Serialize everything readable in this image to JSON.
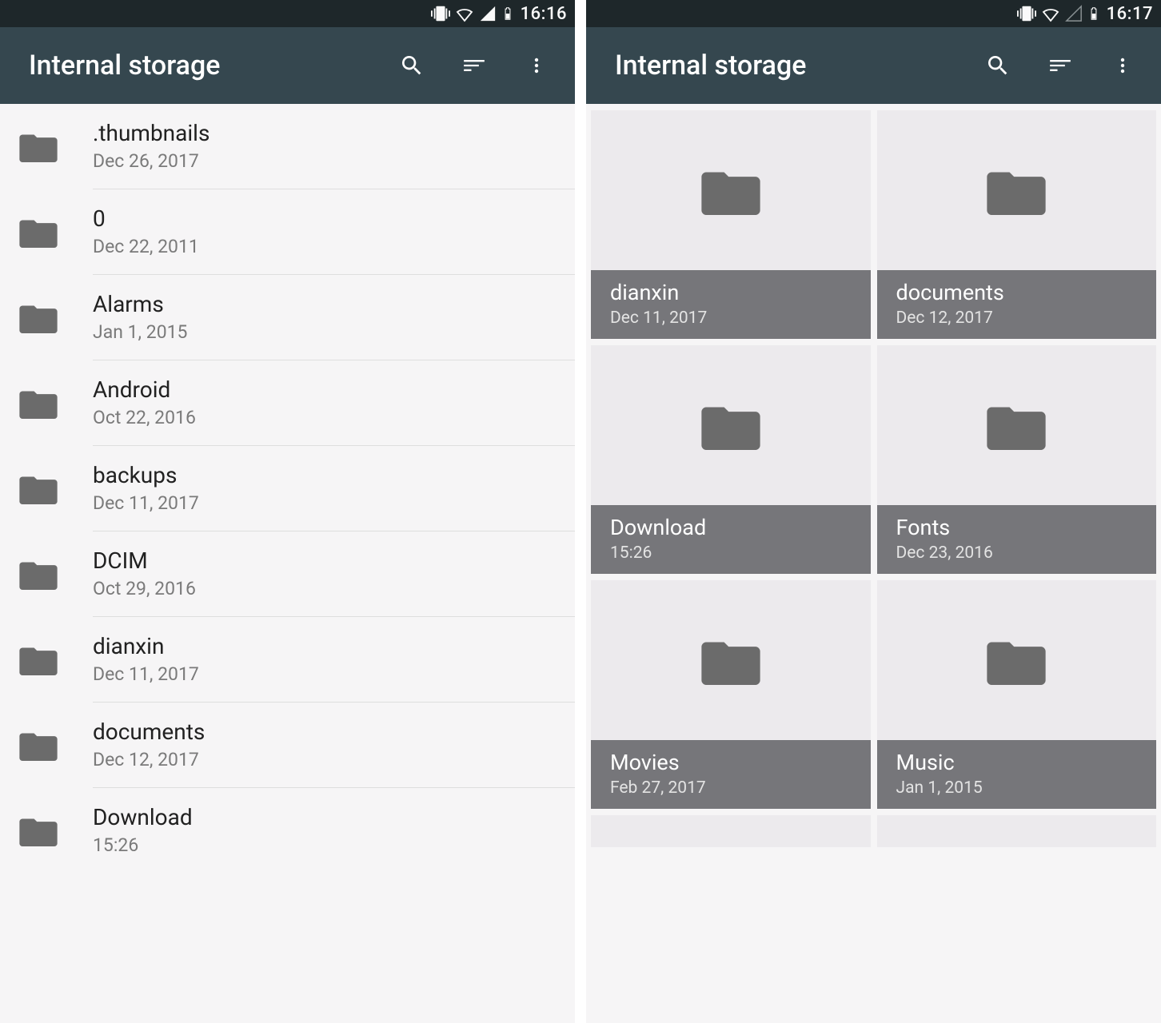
{
  "left": {
    "status": {
      "time": "16:16"
    },
    "header": {
      "title": "Internal storage"
    },
    "items": [
      {
        "name": ".thumbnails",
        "date": "Dec 26, 2017"
      },
      {
        "name": "0",
        "date": "Dec 22, 2011"
      },
      {
        "name": "Alarms",
        "date": "Jan 1, 2015"
      },
      {
        "name": "Android",
        "date": "Oct 22, 2016"
      },
      {
        "name": "backups",
        "date": "Dec 11, 2017"
      },
      {
        "name": "DCIM",
        "date": "Oct 29, 2016"
      },
      {
        "name": "dianxin",
        "date": "Dec 11, 2017"
      },
      {
        "name": "documents",
        "date": "Dec 12, 2017"
      },
      {
        "name": "Download",
        "date": "15:26"
      }
    ]
  },
  "right": {
    "status": {
      "time": "16:17"
    },
    "header": {
      "title": "Internal storage"
    },
    "items": [
      {
        "name": "dianxin",
        "date": "Dec 11, 2017"
      },
      {
        "name": "documents",
        "date": "Dec 12, 2017"
      },
      {
        "name": "Download",
        "date": "15:26"
      },
      {
        "name": "Fonts",
        "date": "Dec 23, 2016"
      },
      {
        "name": "Movies",
        "date": "Feb 27, 2017"
      },
      {
        "name": "Music",
        "date": "Jan 1, 2015"
      }
    ]
  }
}
